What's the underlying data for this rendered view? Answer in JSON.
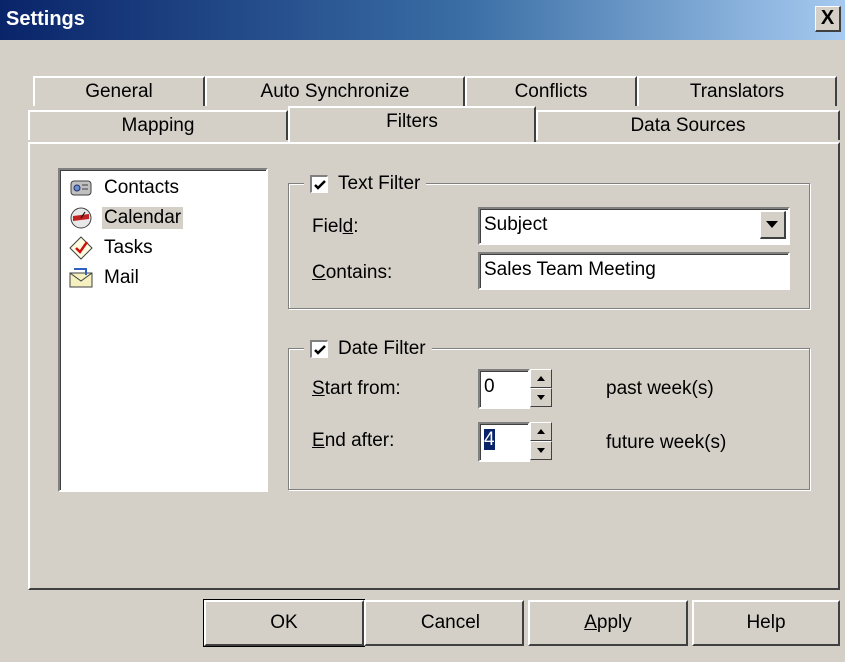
{
  "window": {
    "title": "Settings",
    "close": "X"
  },
  "tabs_row1": [
    "General",
    "Auto Synchronize",
    "Conflicts",
    "Translators"
  ],
  "tabs_row2": [
    "Mapping",
    "Filters",
    "Data Sources"
  ],
  "list": [
    {
      "label": "Contacts",
      "icon": "contacts-icon"
    },
    {
      "label": "Calendar",
      "icon": "calendar-icon",
      "selected": true
    },
    {
      "label": "Tasks",
      "icon": "tasks-icon"
    },
    {
      "label": "Mail",
      "icon": "mail-icon"
    }
  ],
  "text_filter": {
    "title": "Text Filter",
    "checked": true,
    "field_label_pre": "Fiel",
    "field_label_ul": "d",
    "field_label_post": ":",
    "field_value": "Subject",
    "contains_label_ul": "C",
    "contains_label_post": "ontains:",
    "contains_value": "Sales Team Meeting"
  },
  "date_filter": {
    "title": "Date Filter",
    "checked": true,
    "start_label_ul": "S",
    "start_label_post": "tart from:",
    "start_value": "0",
    "start_suffix": "past week(s)",
    "end_label_ul": "E",
    "end_label_post": "nd after:",
    "end_value": "4",
    "end_suffix": "future week(s)"
  },
  "buttons": {
    "ok": "OK",
    "cancel": "Cancel",
    "apply_ul": "A",
    "apply_post": "pply",
    "help": "Help"
  }
}
